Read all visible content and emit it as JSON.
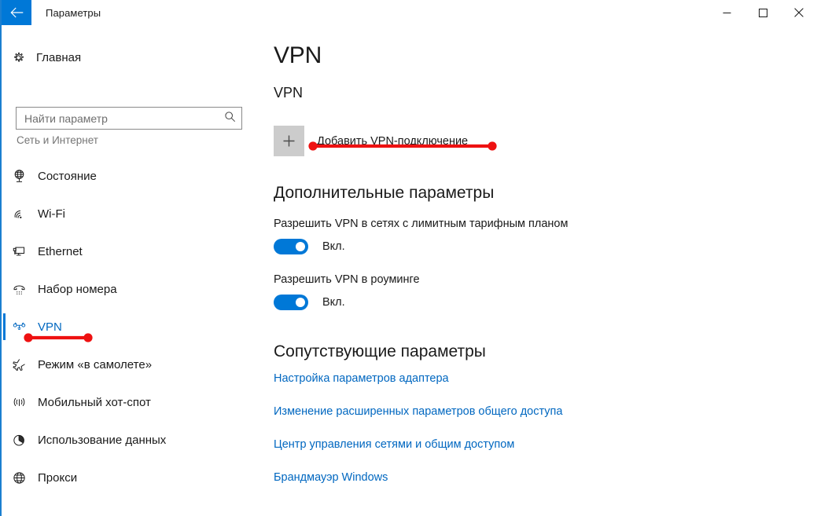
{
  "window": {
    "title": "Параметры",
    "back_icon": "back-arrow-icon",
    "minimize_label": "—",
    "maximize_label": "□",
    "close_label": "✕",
    "accent_color": "#0078d7"
  },
  "sidebar": {
    "home": {
      "label": "Главная",
      "icon": "gear-icon"
    },
    "search": {
      "placeholder": "Найти параметр",
      "value": "",
      "icon": "search-icon"
    },
    "category_label": "Сеть и Интернет",
    "items": [
      {
        "label": "Состояние",
        "icon": "globe-status-icon",
        "selected": false
      },
      {
        "label": "Wi-Fi",
        "icon": "wifi-icon",
        "selected": false
      },
      {
        "label": "Ethernet",
        "icon": "ethernet-monitor-icon",
        "selected": false
      },
      {
        "label": "Набор номера",
        "icon": "dialup-phone-icon",
        "selected": false
      },
      {
        "label": "VPN",
        "icon": "vpn-key-icon",
        "selected": true
      },
      {
        "label": "Режим «в самолете»",
        "icon": "airplane-icon",
        "selected": false
      },
      {
        "label": "Мобильный хот-спот",
        "icon": "hotspot-antenna-icon",
        "selected": false
      },
      {
        "label": "Использование данных",
        "icon": "pie-chart-icon",
        "selected": false
      },
      {
        "label": "Прокси",
        "icon": "globe-icon",
        "selected": false
      }
    ]
  },
  "main": {
    "page_title": "VPN",
    "sub_head": "VPN",
    "add_connection": {
      "label": "Добавить VPN-подключение",
      "icon": "plus-icon"
    },
    "advanced_heading": "Дополнительные параметры",
    "options": [
      {
        "label": "Разрешить VPN в сетях с лимитным тарифным планом",
        "state_text": "Вкл.",
        "on": true
      },
      {
        "label": "Разрешить VPN в роуминге",
        "state_text": "Вкл.",
        "on": true
      }
    ],
    "related_heading": "Сопутствующие параметры",
    "related_links": [
      "Настройка параметров адаптера",
      "Изменение расширенных параметров общего доступа",
      "Центр управления сетями и общим доступом",
      "Брандмауэр Windows"
    ]
  },
  "annotations": {
    "color": "#ee1111",
    "items": [
      {
        "name": "annotation-line-add-vpn"
      },
      {
        "name": "annotation-line-sidebar-vpn"
      }
    ]
  }
}
